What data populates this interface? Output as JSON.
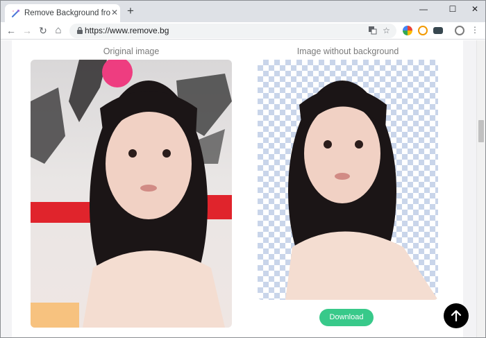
{
  "browser": {
    "tab_title": "Remove Background from Ima",
    "tab_close": "✕",
    "new_tab": "+",
    "minimize": "—",
    "maximize": "☐",
    "close": "✕",
    "url": "https://www.remove.bg",
    "back": "←",
    "forward": "→",
    "reload": "↻",
    "home": "⌂"
  },
  "page": {
    "original_title": "Original image",
    "result_title": "Image without background",
    "download_label": "Download"
  },
  "colors": {
    "download_green": "#38c98a",
    "checker_blue": "#c9d5ea"
  }
}
